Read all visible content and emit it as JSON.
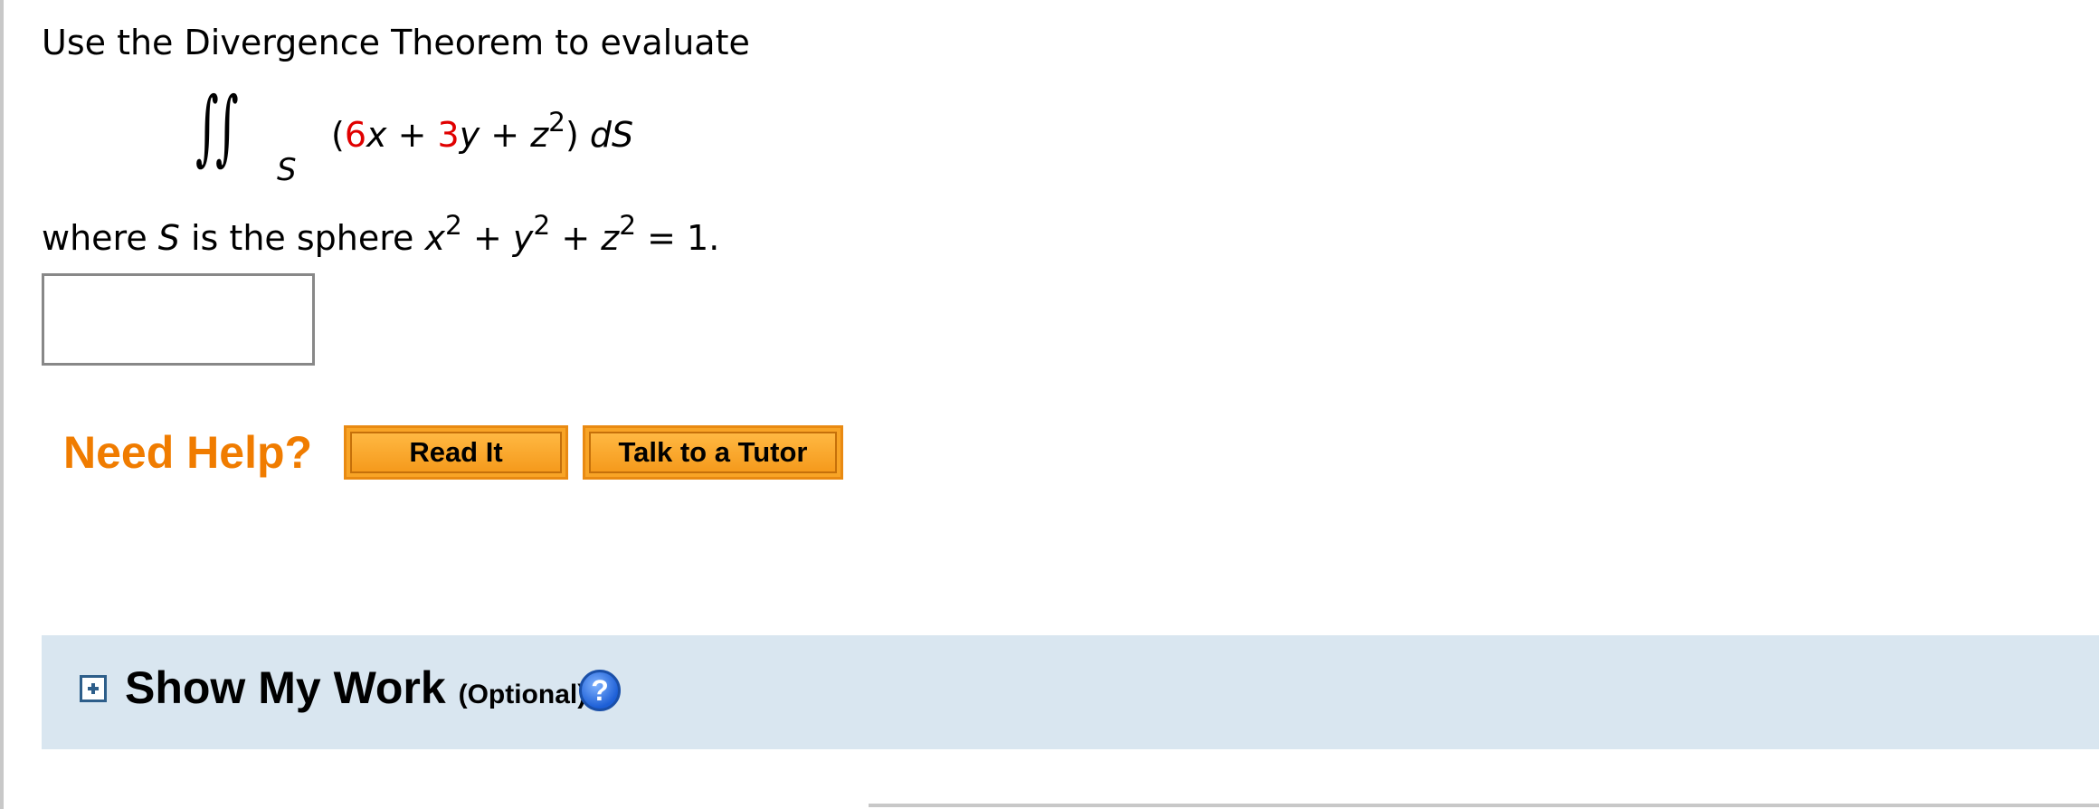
{
  "question": {
    "prompt": "Use the Divergence Theorem to evaluate",
    "integral": {
      "subscript": "S",
      "open_paren": "(",
      "coef_x": "6",
      "var_x": "x",
      "plus1": " + ",
      "coef_y": "3",
      "var_y": "y",
      "plus2": " + ",
      "var_z": "z",
      "exp_z": "2",
      "close_paren": ")",
      "differential": " dS"
    },
    "where_prefix": "where ",
    "where_S": "S",
    "where_mid": " is the sphere ",
    "sphere_x": "x",
    "sphere_y": "y",
    "sphere_z": "z",
    "sphere_exp": "2",
    "sphere_plus": " + ",
    "sphere_eq": " = 1."
  },
  "answer": {
    "value": ""
  },
  "help": {
    "label": "Need Help?",
    "read_it": "Read It",
    "talk_tutor": "Talk to a Tutor"
  },
  "work": {
    "title": "Show My Work",
    "optional": "(Optional)",
    "help_glyph": "?"
  },
  "colors": {
    "accent_orange": "#f07c00",
    "coefficient_red": "#e00000",
    "panel_blue": "#d9e6f0"
  }
}
